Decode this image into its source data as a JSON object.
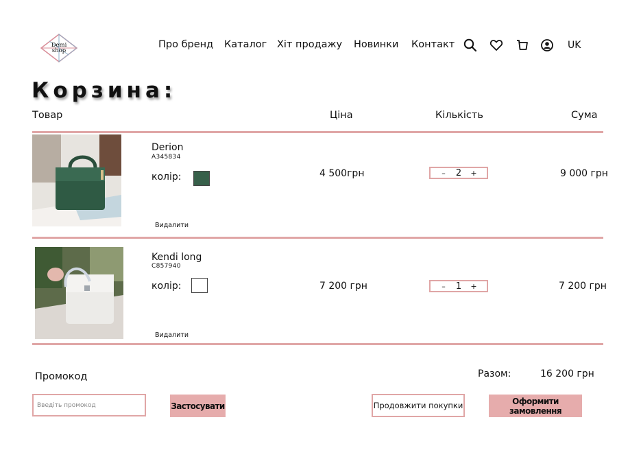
{
  "header": {
    "logo_text": "Demi shop",
    "nav": [
      "Про бренд",
      "Каталог",
      "Хіт продажу",
      "Новинки",
      "Контакт"
    ],
    "icons": [
      "search-icon",
      "heart-icon",
      "cart-icon",
      "user-icon"
    ],
    "lang": "UK"
  },
  "page_title": "Корзина:",
  "columns": {
    "product": "Товар",
    "price": "Ціна",
    "quantity": "Кількість",
    "sum": "Сума"
  },
  "items": [
    {
      "name": "Derion",
      "sku": "A345834",
      "color_label": "колір:",
      "color": "#37604a",
      "price": "4 500грн",
      "qty": "2",
      "sum": "9 000 грн",
      "remove": "Видалити"
    },
    {
      "name": "Kendi long",
      "sku": "C857940",
      "color_label": "колір:",
      "color": "#ffffff",
      "price": "7 200 грн",
      "qty": "1",
      "sum": "7 200 грн",
      "remove": "Видалити"
    }
  ],
  "qty_minus": "–",
  "qty_plus": "+",
  "promo": {
    "label": "Промокод",
    "placeholder": "Введіть промокод",
    "apply": "Застосувати"
  },
  "total": {
    "label": "Разом:",
    "value": "16 200 грн"
  },
  "actions": {
    "continue": "Продовжити покупки",
    "checkout": "Оформити замовлення"
  },
  "colors": {
    "accent": "#e0a6a6",
    "button": "#e6acac"
  }
}
